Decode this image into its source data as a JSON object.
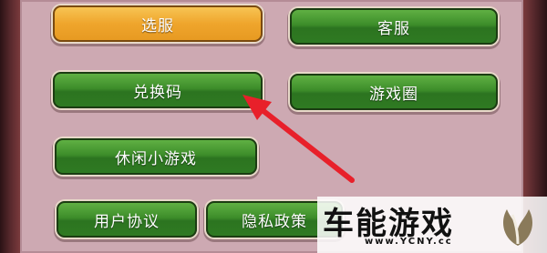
{
  "menu": {
    "server_select": "选服",
    "customer_service": "客服",
    "redeem_code": "兑换码",
    "game_circle": "游戏圈",
    "casual_games": "休闲小游戏",
    "user_agreement": "用户协议",
    "privacy_policy": "隐私政策"
  },
  "watermark": {
    "site_name": "车能游戏",
    "url": "www.YCNY.cc"
  },
  "colors": {
    "button_green": "#3d8d2a",
    "button_orange": "#efa52c",
    "panel": "#cda9b2",
    "arrow": "#e8202a"
  }
}
